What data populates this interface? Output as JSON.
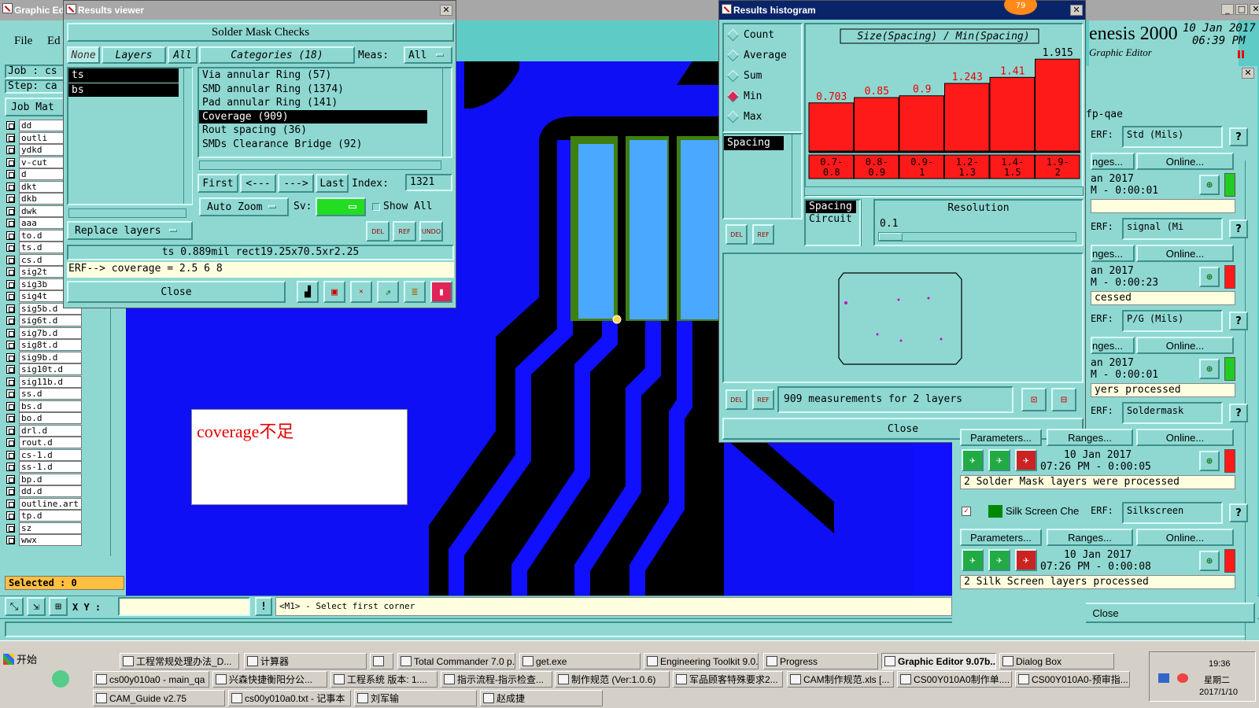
{
  "graphic_editor": {
    "title": "Graphic Editor",
    "menu": [
      "File",
      "Ed"
    ],
    "job_label": "Job : cs",
    "step_label": "Step: ca",
    "job_matrix_btn": "Job Mat",
    "layers": [
      "dd",
      "outli",
      "ydkd",
      "v-cut",
      "d",
      "dkt",
      "dkb",
      "dwk",
      "aaa",
      "to.d",
      "ts.d",
      "cs.d",
      "sig2t",
      "sig3b",
      "sig4t",
      "sig5b.d",
      "sig6t.d",
      "sig7b.d",
      "sig8t.d",
      "sig9b.d",
      "sig10t.d",
      "sig11b.d",
      "ss.d",
      "bs.d",
      "bo.d",
      "drl.d",
      "rout.d",
      "cs-1.d",
      "ss-1.d",
      "bp.d",
      "dd.d",
      "outline.art",
      "tp.d",
      "sz",
      "wwx"
    ],
    "selected_label": "Selected : 0",
    "xy_label": "X Y :",
    "prompt": "<M1> - Select first corner",
    "annotation_text": "coverage不足",
    "brand": "enesis 2000",
    "brand_sub": "Graphic Editor",
    "date": "10 Jan 2017",
    "time": "06:39 PM"
  },
  "results_viewer": {
    "title": "Results viewer",
    "header": "Solder Mask Checks",
    "layers_tabs": {
      "none": "None",
      "layers": "Layers",
      "all": "All"
    },
    "layer_items": [
      "ts",
      "bs"
    ],
    "categories_label": "Categories (18)",
    "meas_label": "Meas:",
    "meas_value": "All",
    "categories": [
      {
        "label": "Via annular Ring (57)",
        "selected": false
      },
      {
        "label": "SMD annular Ring (1374)",
        "selected": false
      },
      {
        "label": "Pad annular Ring (141)",
        "selected": false
      },
      {
        "label": "Coverage (909)",
        "selected": true
      },
      {
        "label": "Rout spacing (36)",
        "selected": false
      },
      {
        "label": "SMDs Clearance Bridge (92)",
        "selected": false
      }
    ],
    "nav": {
      "first": "First",
      "prev": "<---",
      "next": "--->",
      "last": "Last",
      "index_label": "Index:",
      "index_value": "1321"
    },
    "auto_zoom": "Auto Zoom",
    "sv_label": "Sv:",
    "show_all": "Show All",
    "replace_layers": "Replace layers",
    "del": "DEL",
    "ref": "REF",
    "undo": "UNDO",
    "status": "ts 0.889mil   rect19.25x70.5xr2.25",
    "erf": "ERF--> coverage = 2.5 6 8",
    "close": "Close"
  },
  "histogram": {
    "title": "Results histogram",
    "badge": "79",
    "options": [
      {
        "label": "Count",
        "on": false
      },
      {
        "label": "Average",
        "on": false
      },
      {
        "label": "Sum",
        "on": false
      },
      {
        "label": "Min",
        "on": true
      },
      {
        "label": "Max",
        "on": false
      }
    ],
    "list_item": "Spacing",
    "del": "DEL",
    "ref": "REF",
    "spacing_circuit": [
      "Spacing",
      "Circuit"
    ],
    "resolution_label": "Resolution",
    "resolution_value": "0.1",
    "measurements": "909 measurements for 2 layers",
    "close": "Close"
  },
  "chart_data": {
    "type": "bar",
    "title": "Size(Spacing) / Min(Spacing)",
    "categories": [
      "0.7-0.8",
      "0.8-0.9",
      "0.9-1",
      "1.2-1.3",
      "1.4-1.5",
      "1.9-2"
    ],
    "category_lines": [
      [
        "0.7-",
        "0.8"
      ],
      [
        "0.8-",
        "0.9"
      ],
      [
        "0.9-",
        "1"
      ],
      [
        "1.2-",
        "1.3"
      ],
      [
        "1.4-",
        "1.5"
      ],
      [
        "1.9-",
        "2"
      ]
    ],
    "values": [
      0.703,
      0.85,
      0.9,
      1.243,
      1.41,
      1.915
    ],
    "value_labels": [
      "0.703",
      "0.85",
      "0.9",
      "1.243",
      "1.41",
      "1.915"
    ],
    "ylim": [
      0,
      2.05
    ],
    "bar_color": "#ff1a1a"
  },
  "checklist": {
    "title": "fp-qae",
    "rows": [
      {
        "erf": "Std (Mils)",
        "ranges": "nges...",
        "online": "Online...",
        "date": "an 2017",
        "elapsed": "M - 0:00:01",
        "status": "",
        "indicator": "#22cc22"
      },
      {
        "erf": "signal (Mi",
        "ranges": "nges...",
        "online": "Online...",
        "date": "an 2017",
        "elapsed": "M - 0:00:23",
        "status": "cessed",
        "indicator": "#ff1a1a"
      },
      {
        "erf": "P/G (Mils)",
        "ranges": "nges...",
        "online": "Online...",
        "date": "an 2017",
        "elapsed": "M - 0:00:01",
        "status": "yers processed",
        "indicator": "#22cc22"
      },
      {
        "erf": "Soldermask",
        "ranges": "Ranges...",
        "online": "Online...",
        "params": "Parameters...",
        "date": "10 Jan 2017",
        "elapsed": "07:26 PM - 0:00:05",
        "status": "2 Solder Mask layers were processed",
        "indicator": "#ff1a1a"
      },
      {
        "erf": "Silkscreen",
        "name": "Silk Screen Che",
        "ranges": "Ranges...",
        "online": "Online...",
        "params": "Parameters...",
        "date": "10 Jan 2017",
        "elapsed": "07:26 PM - 0:00:08",
        "status": "2 Silk Screen layers processed",
        "indicator": "#ff1a1a"
      }
    ],
    "erf_label": "ERF:",
    "help": "?",
    "close": "Close"
  },
  "taskbar": {
    "start": "开始",
    "clock": "19:36",
    "weekday": "星期二",
    "date": "2017/1/10",
    "row1": [
      "工程常规处理办法_D...",
      "计算器",
      "",
      "Total Commander 7.0 p...",
      "get.exe",
      "Engineering Toolkit 9.0....",
      "Progress",
      "Graphic Editor 9.07b...",
      "Dialog Box"
    ],
    "row2": [
      "cs00y010a0 - main_qa",
      "兴森快捷衡阳分公...",
      "工程系统  版本: 1....",
      "指示流程-指示检查...",
      "制作规范 (Ver:1.0.6)",
      "军品顾客特殊要求2...",
      "CAM制作规范.xls [...",
      "CS00Y010A0制作单....",
      "CS00Y010A0-预审指..."
    ],
    "row3": [
      "CAM_Guide v2.75",
      "cs00y010a0.txt - 记事本",
      "刘军输",
      "赵成捷"
    ]
  }
}
